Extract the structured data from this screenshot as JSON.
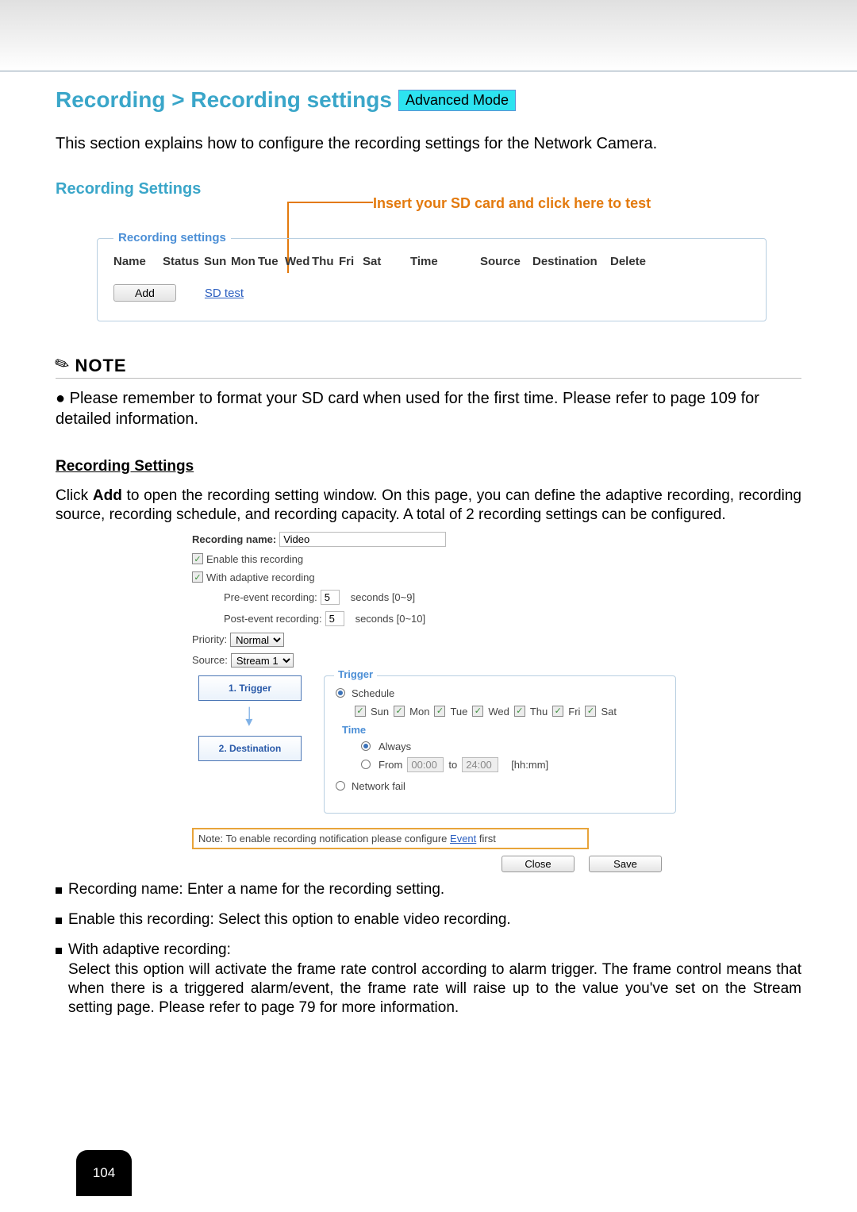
{
  "breadcrumb": "Recording > Recording settings",
  "mode_badge": "Advanced Mode",
  "intro": "This section explains how to configure the recording settings for the Network Camera.",
  "subhead": "Recording Settings",
  "callout": "Insert your SD card and click here to test",
  "fieldset_legend": "Recording settings",
  "table_cols": {
    "name": "Name",
    "status": "Status",
    "sun": "Sun",
    "mon": "Mon",
    "tue": "Tue",
    "wed": "Wed",
    "thu": "Thu",
    "fri": "Fri",
    "sat": "Sat",
    "time": "Time",
    "source": "Source",
    "destination": "Destination",
    "delete": "Delete"
  },
  "add_btn": "Add",
  "sd_test": "SD test",
  "note": {
    "title": "NOTE",
    "body_prefix": "● ",
    "body": "Please remember to format your SD card when used for the first time. Please refer to page 109 for detailed information."
  },
  "section_head": "Recording Settings",
  "para_prefix": "Click ",
  "para_bold": "Add",
  "para_rest": " to open the recording setting window. On this page, you can define the adaptive recording, recording source, recording schedule, and recording capacity. A total of 2 recording settings can be configured.",
  "form": {
    "rec_name_label": "Recording name:",
    "rec_name_value": "Video",
    "enable": "Enable this recording",
    "adaptive": "With adaptive recording",
    "pre_label": "Pre-event recording:",
    "pre_val": "5",
    "pre_hint": "seconds [0~9]",
    "post_label": "Post-event recording:",
    "post_val": "5",
    "post_hint": "seconds [0~10]",
    "priority_label": "Priority:",
    "priority_val": "Normal",
    "source_label": "Source:",
    "source_val": "Stream 1",
    "trigger_legend": "Trigger",
    "schedule": "Schedule",
    "days": {
      "sun": "Sun",
      "mon": "Mon",
      "tue": "Tue",
      "wed": "Wed",
      "thu": "Thu",
      "fri": "Fri",
      "sat": "Sat"
    },
    "time_label": "Time",
    "always": "Always",
    "from": "From",
    "from_val": "00:00",
    "to": "to",
    "to_val": "24:00",
    "hhmm": "[hh:mm]",
    "network_fail": "Network fail",
    "steps": {
      "trigger": "1. Trigger",
      "dest": "2. Destination"
    },
    "event_note_prefix": "Note: To enable recording notification please configure ",
    "event_link": "Event",
    "event_note_suffix": " first",
    "close": "Close",
    "save": "Save"
  },
  "bullets": {
    "b1": "Recording name: Enter a name for the recording setting.",
    "b2": "Enable this recording: Select this option to enable video recording.",
    "b3a": "With adaptive recording:",
    "b3b": "Select this option will activate the frame rate control according to alarm trigger. The frame control means that when there is a triggered alarm/event, the frame rate will raise up to the value you've set on the Stream setting page. Please refer to page 79 for more information."
  },
  "page_num": "104"
}
